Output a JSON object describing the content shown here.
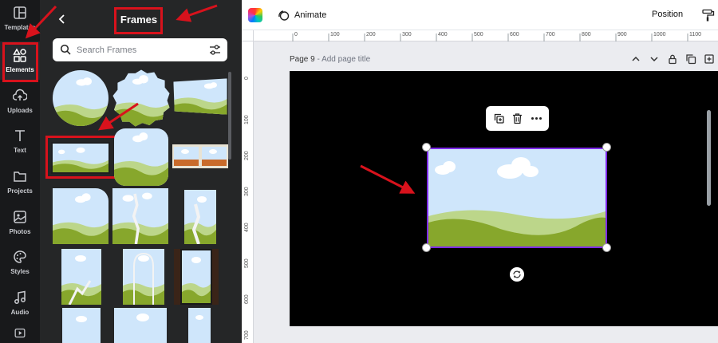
{
  "rail": {
    "items": [
      {
        "label": "Templates",
        "icon": "templates-icon"
      },
      {
        "label": "Elements",
        "icon": "elements-icon"
      },
      {
        "label": "Uploads",
        "icon": "uploads-icon"
      },
      {
        "label": "Text",
        "icon": "text-icon"
      },
      {
        "label": "Projects",
        "icon": "projects-icon"
      },
      {
        "label": "Photos",
        "icon": "photos-icon"
      },
      {
        "label": "Styles",
        "icon": "styles-icon"
      },
      {
        "label": "Audio",
        "icon": "audio-icon"
      }
    ],
    "active": "Elements"
  },
  "panel": {
    "title": "Frames",
    "search_placeholder": "Search Frames"
  },
  "topbar": {
    "animate_label": "Animate",
    "position_label": "Position"
  },
  "ruler": {
    "top_ticks": [
      "0",
      "100",
      "200",
      "300",
      "400",
      "500",
      "600",
      "700",
      "800",
      "900",
      "1000",
      "1100"
    ],
    "left_ticks": [
      "0",
      "100",
      "200",
      "300",
      "400",
      "500",
      "600",
      "700"
    ]
  },
  "page": {
    "number": "Page 9",
    "separator": "-",
    "title_placeholder": "Add page title"
  },
  "colors": {
    "annotation_red": "#d8121c",
    "selection_purple": "#7d2ae8",
    "sky": "#cfe6fb",
    "grass_dark": "#87a72c",
    "grass_light": "#bcd68a"
  }
}
